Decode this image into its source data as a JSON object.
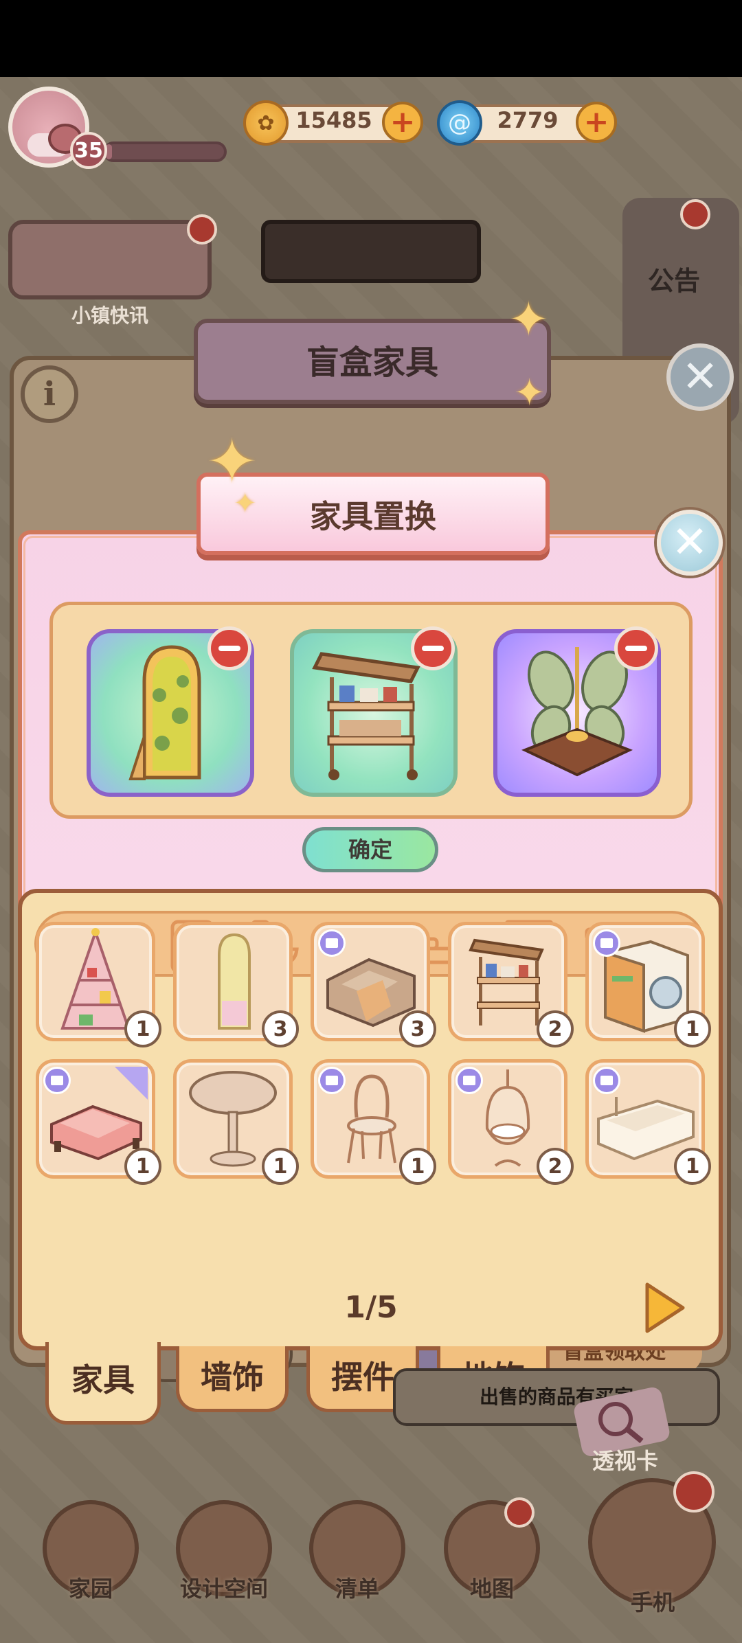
{
  "hud": {
    "level": "35",
    "xp_progress": 0.05,
    "coins": "15485",
    "gems": "2779"
  },
  "background": {
    "news_label": "小镇快讯",
    "notice_label": "公告",
    "blindbox_title": "盲盒家具",
    "receive_label": "盲盒领取处",
    "hint_text": "出售的商品有买家",
    "lens_card_label": "透视卡",
    "nav": [
      "家园",
      "设计空间",
      "清单",
      "地图",
      "手机"
    ]
  },
  "dialog": {
    "title": "家具置换",
    "confirm_label": "确定",
    "selected_slots": [
      {
        "icon": "mirror-icon"
      },
      {
        "icon": "shelf-cart-icon"
      },
      {
        "icon": "windmill-decor-icon"
      }
    ],
    "category_icons": [
      "all-grid-icon",
      "fridge-icon",
      "toilet-icon",
      "stool-icon",
      "bed-icon",
      "cabinet-icon",
      "table-icon",
      "more-icon"
    ],
    "items": [
      {
        "icon": "christmas-tree-shelf-icon",
        "count": "1",
        "tag": false,
        "flag": false
      },
      {
        "icon": "floor-mirror-icon",
        "count": "3",
        "tag": false,
        "flag": false
      },
      {
        "icon": "sofa-icon",
        "count": "3",
        "tag": true,
        "flag": false
      },
      {
        "icon": "shelf-cart-icon",
        "count": "2",
        "tag": false,
        "flag": false
      },
      {
        "icon": "washing-machine-icon",
        "count": "1",
        "tag": true,
        "flag": false
      },
      {
        "icon": "pink-bed-icon",
        "count": "1",
        "tag": true,
        "flag": true
      },
      {
        "icon": "round-table-icon",
        "count": "1",
        "tag": false,
        "flag": false
      },
      {
        "icon": "bistro-chair-icon",
        "count": "1",
        "tag": true,
        "flag": false
      },
      {
        "icon": "hanging-chair-icon",
        "count": "2",
        "tag": true,
        "flag": false
      },
      {
        "icon": "bathtub-icon",
        "count": "1",
        "tag": true,
        "flag": false
      }
    ],
    "page": "1/5",
    "tabs": [
      "家具",
      "墙饰",
      "摆件",
      "地饰"
    ],
    "active_tab": 0
  },
  "colors": {
    "panel_pink": "#f7d3e7",
    "panel_cream": "#f7dfae",
    "accent_orange": "#d1795c",
    "confirm_green": "#7fe0d0"
  }
}
